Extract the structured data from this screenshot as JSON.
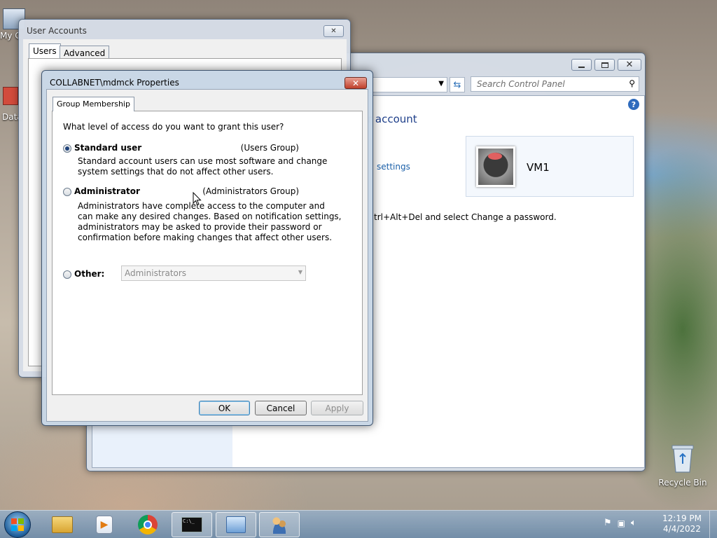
{
  "desktop": {
    "icons": [
      {
        "label": "My C"
      },
      {
        "label": "Data"
      },
      {
        "label": "Recycle Bin"
      }
    ]
  },
  "control_panel": {
    "search_placeholder": "Search Control Panel",
    "heading_fragment": "r account",
    "settings_link_fragment": "settings",
    "password_hint_fragment": "trl+Alt+Del and select Change a password.",
    "account_name": "VM1"
  },
  "user_accounts": {
    "title": "User Accounts",
    "tabs": [
      {
        "label": "Users"
      },
      {
        "label": "Advanced"
      }
    ]
  },
  "properties": {
    "title": "COLLABNET\\mdmck Properties",
    "tab": "Group Membership",
    "question": "What level of access do you want to grant this user?",
    "options": [
      {
        "label": "Standard user",
        "group": "(Users Group)",
        "selected": true,
        "description": [
          "Standard account users can use most software and change",
          "system settings that do not affect other users."
        ]
      },
      {
        "label": "Administrator",
        "group": "(Administrators Group)",
        "selected": false,
        "description": [
          "Administrators have complete access to the computer and",
          "can make any desired changes. Based on notification settings,",
          "administrators may be asked to provide their password or",
          "confirmation before making changes that affect other users."
        ]
      }
    ],
    "other_label": "Other:",
    "other_value": "Administrators",
    "buttons": {
      "ok": "OK",
      "cancel": "Cancel",
      "apply": "Apply"
    }
  },
  "taskbar": {
    "items": [
      {
        "icon": "start-orb-icon"
      },
      {
        "icon": "file-explorer-icon"
      },
      {
        "icon": "media-player-icon"
      },
      {
        "icon": "chrome-icon"
      },
      {
        "icon": "command-prompt-icon"
      },
      {
        "icon": "control-panel-icon"
      },
      {
        "icon": "user-accounts-icon"
      }
    ],
    "time": "12:19 PM",
    "date": "4/4/2022"
  }
}
